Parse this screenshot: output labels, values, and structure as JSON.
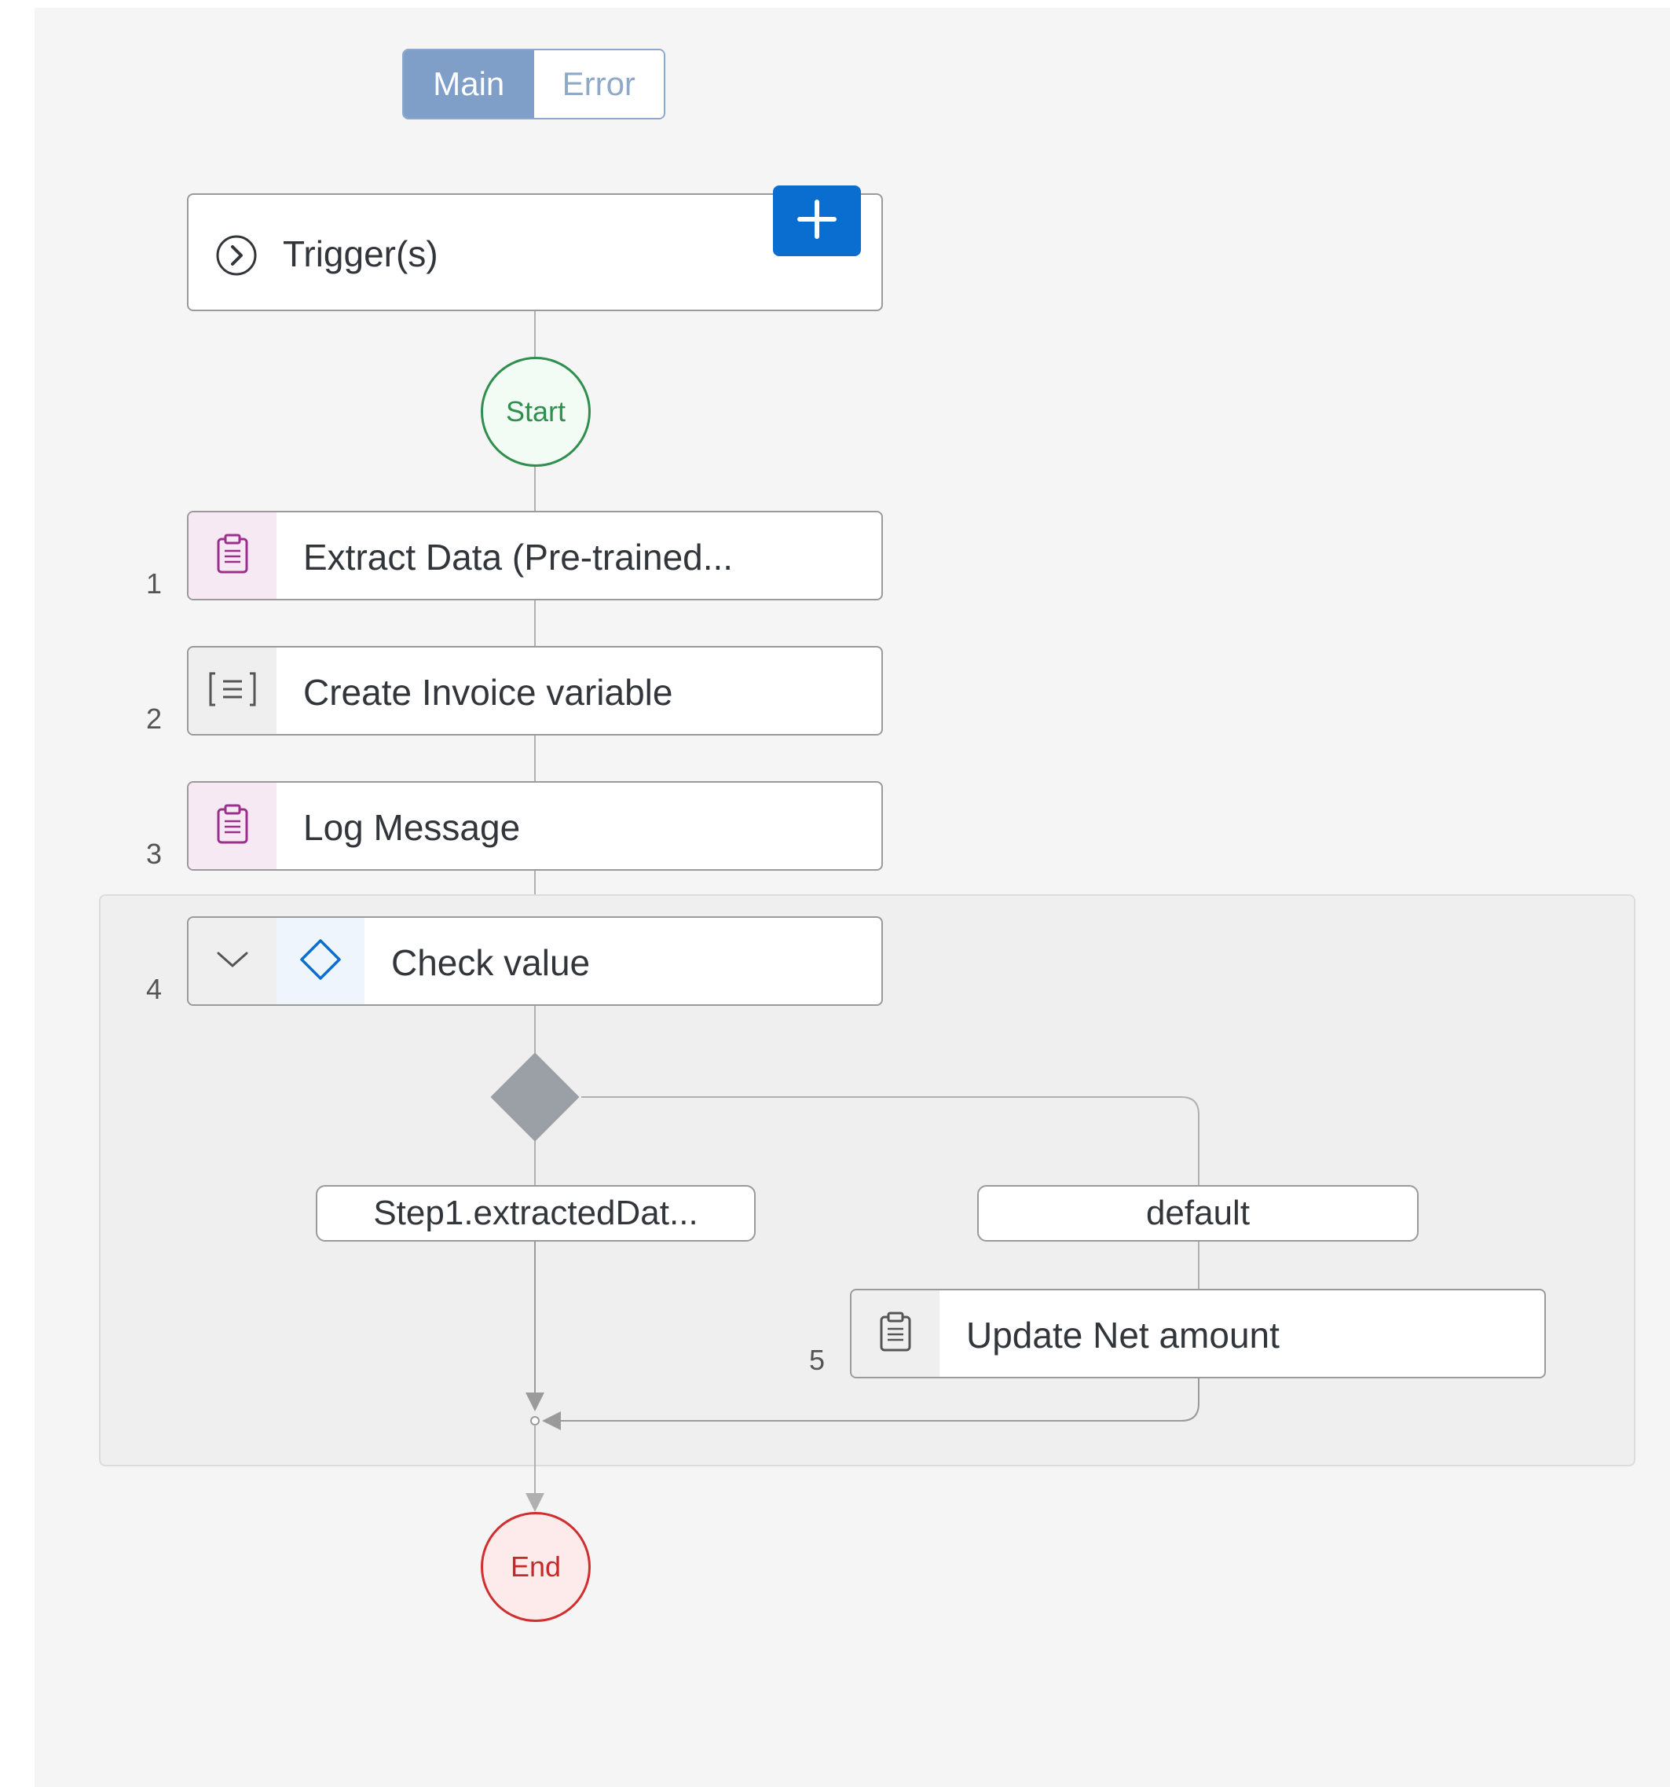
{
  "tabs": {
    "main": "Main",
    "error": "Error"
  },
  "trigger": {
    "label": "Trigger(s)",
    "icon": "chevron-right-circle-icon",
    "add_icon": "plus-icon"
  },
  "start": {
    "label": "Start"
  },
  "end": {
    "label": "End"
  },
  "steps": [
    {
      "num": "1",
      "label": "Extract Data (Pre-trained...",
      "icon": "clipboard-icon"
    },
    {
      "num": "2",
      "label": "Create Invoice variable",
      "icon": "variable-icon"
    },
    {
      "num": "3",
      "label": "Log Message",
      "icon": "clipboard-icon"
    },
    {
      "num": "4",
      "label": "Check value",
      "icon": "diamond-icon",
      "toggle_icon": "chevron-down-icon"
    },
    {
      "num": "5",
      "label": "Update Net amount",
      "icon": "clipboard-icon"
    }
  ],
  "branches": {
    "condition": "Step1.extractedDat...",
    "default": "default"
  },
  "colors": {
    "accent": "#0a6ed1",
    "start": "#2f8f4e",
    "end": "#d12f2f",
    "tab_active": "#7f9fc9"
  }
}
